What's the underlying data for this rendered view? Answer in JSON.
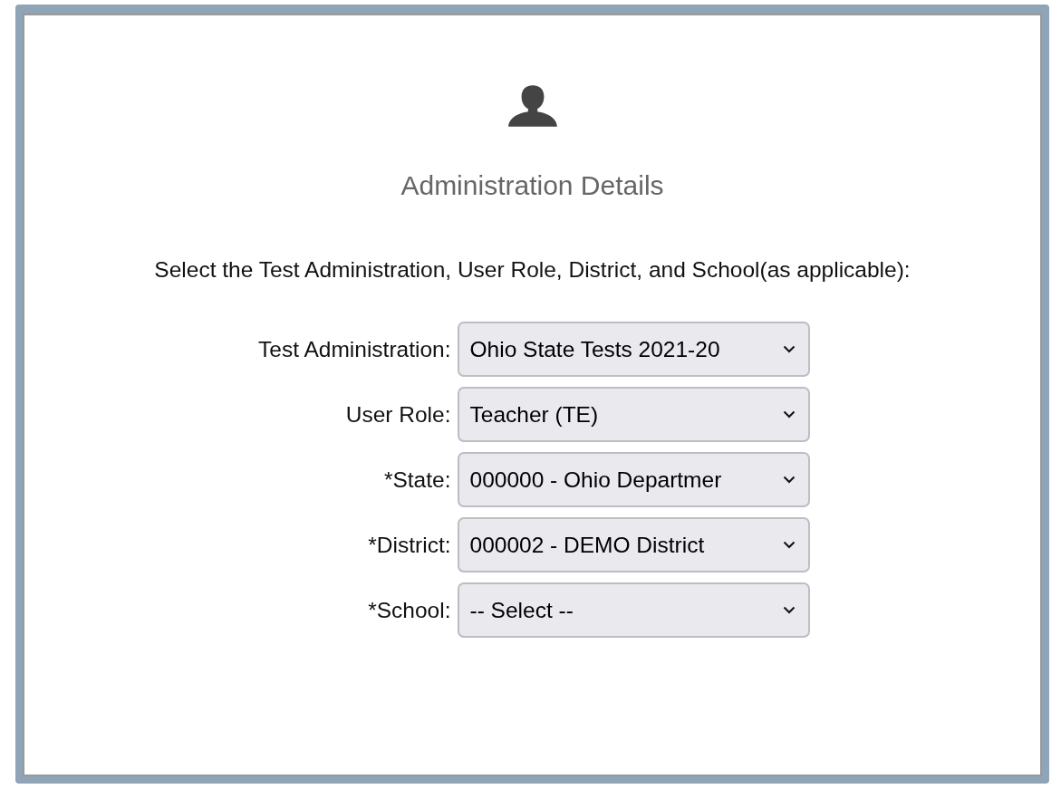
{
  "heading": "Administration Details",
  "instructions": "Select the Test Administration, User Role, District, and School(as applicable):",
  "fields": [
    {
      "label": "Test Administration:",
      "value": "Ohio State Tests 2021-20"
    },
    {
      "label": "User Role:",
      "value": "Teacher (TE)"
    },
    {
      "label": "*State:",
      "value": "000000 - Ohio Departmer"
    },
    {
      "label": "*District:",
      "value": "000002 - DEMO District"
    },
    {
      "label": "*School:",
      "value": "-- Select --"
    }
  ]
}
